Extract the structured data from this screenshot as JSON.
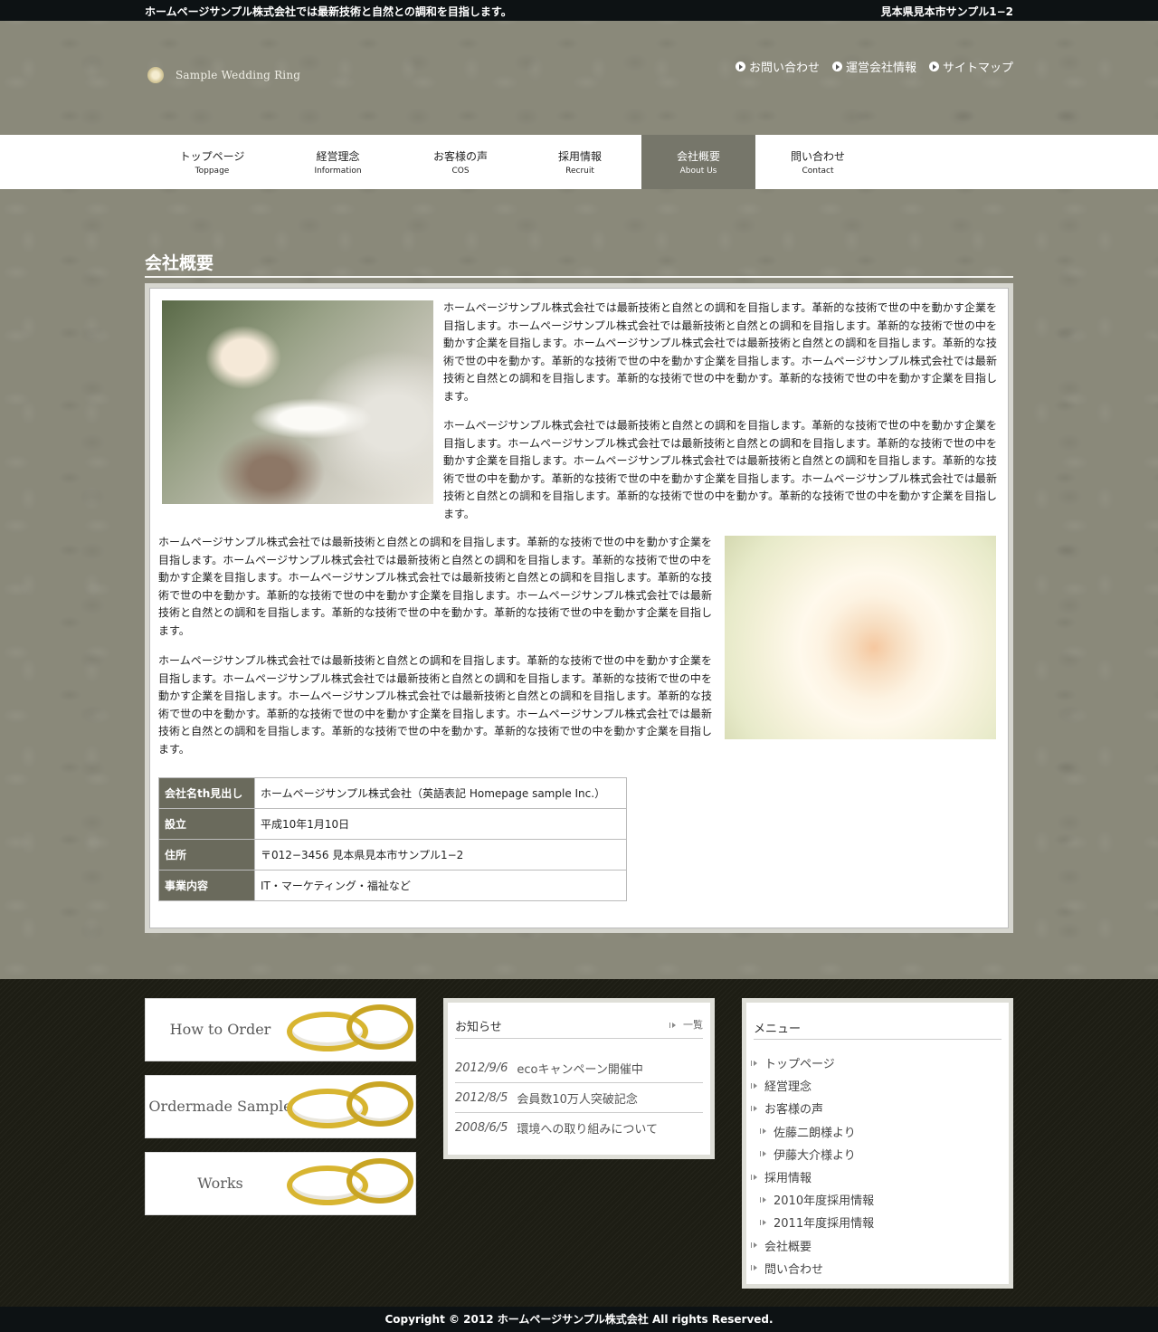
{
  "topbar": {
    "tagline": "ホームページサンプル株式会社では最新技術と自然との調和を目指します。",
    "address": "見本県見本市サンプル1−2"
  },
  "logo": {
    "text": "Sample Wedding Ring"
  },
  "header_links": [
    "お問い合わせ",
    "運営会社情報",
    "サイトマップ"
  ],
  "nav": [
    {
      "jp": "トップページ",
      "en": "Toppage"
    },
    {
      "jp": "経営理念",
      "en": "Information"
    },
    {
      "jp": "お客様の声",
      "en": "COS"
    },
    {
      "jp": "採用情報",
      "en": "Recruit"
    },
    {
      "jp": "会社概要",
      "en": "About Us",
      "active": true
    },
    {
      "jp": "問い合わせ",
      "en": "Contact"
    }
  ],
  "page_title": "会社概要",
  "paragraphs": {
    "p1": "ホームページサンプル株式会社では最新技術と自然との調和を目指します。革新的な技術で世の中を動かす企業を目指します。ホームページサンプル株式会社では最新技術と自然との調和を目指します。革新的な技術で世の中を動かす企業を目指します。ホームページサンプル株式会社では最新技術と自然との調和を目指します。革新的な技術で世の中を動かす。革新的な技術で世の中を動かす企業を目指します。ホームページサンプル株式会社では最新技術と自然との調和を目指します。革新的な技術で世の中を動かす。革新的な技術で世の中を動かす企業を目指します。",
    "p2": "ホームページサンプル株式会社では最新技術と自然との調和を目指します。革新的な技術で世の中を動かす企業を目指します。ホームページサンプル株式会社では最新技術と自然との調和を目指します。革新的な技術で世の中を動かす企業を目指します。ホームページサンプル株式会社では最新技術と自然との調和を目指します。革新的な技術で世の中を動かす。革新的な技術で世の中を動かす企業を目指します。ホームページサンプル株式会社では最新技術と自然との調和を目指します。革新的な技術で世の中を動かす。革新的な技術で世の中を動かす企業を目指します。",
    "p3": "ホームページサンプル株式会社では最新技術と自然との調和を目指します。革新的な技術で世の中を動かす企業を目指します。ホームページサンプル株式会社では最新技術と自然との調和を目指します。革新的な技術で世の中を動かす企業を目指します。ホームページサンプル株式会社では最新技術と自然との調和を目指します。革新的な技術で世の中を動かす。革新的な技術で世の中を動かす企業を目指します。ホームページサンプル株式会社では最新技術と自然との調和を目指します。革新的な技術で世の中を動かす。革新的な技術で世の中を動かす企業を目指します。",
    "p4": "ホームページサンプル株式会社では最新技術と自然との調和を目指します。革新的な技術で世の中を動かす企業を目指します。ホームページサンプル株式会社では最新技術と自然との調和を目指します。革新的な技術で世の中を動かす企業を目指します。ホームページサンプル株式会社では最新技術と自然との調和を目指します。革新的な技術で世の中を動かす。革新的な技術で世の中を動かす企業を目指します。ホームページサンプル株式会社では最新技術と自然との調和を目指します。革新的な技術で世の中を動かす。革新的な技術で世の中を動かす企業を目指します。"
  },
  "company_table": [
    {
      "th": "会社名th見出し",
      "td": "ホームページサンプル株式会社（英語表記 Homepage sample Inc.）"
    },
    {
      "th": "設立",
      "td": "平成10年1月10日"
    },
    {
      "th": "住所",
      "td": "〒012−3456 見本県見本市サンプル1−2"
    },
    {
      "th": "事業内容",
      "td": "IT・マーケティング・福祉など"
    }
  ],
  "banners": [
    "How to Order",
    "Ordermade Sample",
    "Works"
  ],
  "notice": {
    "title": "お知らせ",
    "all_link": "一覧",
    "items": [
      {
        "date": "2012/9/6",
        "text": "ecoキャンペーン開催中"
      },
      {
        "date": "2012/8/5",
        "text": "会員数10万人突破記念"
      },
      {
        "date": "2008/6/5",
        "text": "環境への取り組みについて"
      }
    ]
  },
  "menu": {
    "title": "メニュー",
    "items": [
      {
        "label": "トップページ",
        "sub": false
      },
      {
        "label": "経営理念",
        "sub": false
      },
      {
        "label": "お客様の声",
        "sub": false
      },
      {
        "label": "佐藤二朗様より",
        "sub": true
      },
      {
        "label": "伊藤大介様より",
        "sub": true
      },
      {
        "label": "採用情報",
        "sub": false
      },
      {
        "label": "2010年度採用情報",
        "sub": true
      },
      {
        "label": "2011年度採用情報",
        "sub": true
      },
      {
        "label": "会社概要",
        "sub": false
      },
      {
        "label": "問い合わせ",
        "sub": false
      }
    ]
  },
  "copyright": "Copyright © 2012 ホームページサンプル株式会社 All rights Reserved.",
  "colors": {
    "nav_active": "#76766a",
    "table_header": "#6a6a5c",
    "footer_bg": "#1d1d14",
    "bar_bg": "#0d1214"
  }
}
